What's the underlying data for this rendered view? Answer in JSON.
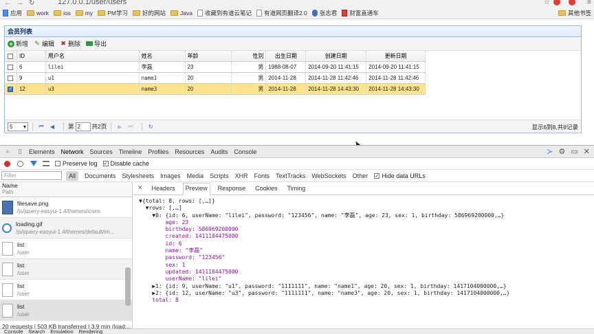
{
  "browser": {
    "url": "127.0.0.1/user/users",
    "bookmarks": [
      "应用",
      "work",
      "ios",
      "my",
      "PM学习",
      "好的网站",
      "Java",
      "收藏到有道云笔记",
      "有道网页翻译2.0",
      "张志君",
      "财富直通车"
    ],
    "other_bookmarks": "其他书签"
  },
  "panel": {
    "title": "会员列表",
    "toolbar": {
      "add": "新增",
      "edit": "编辑",
      "delete": "删除",
      "export": "导出"
    },
    "columns": [
      "ID",
      "用户名",
      "姓名",
      "年龄",
      "性别",
      "出生日期",
      "创建日期",
      "更新日期"
    ],
    "rows": [
      {
        "id": "6",
        "username": "lilei",
        "name": "李磊",
        "age": "23",
        "sex": "男",
        "birthday": "1988-08-07",
        "created": "2014-09-20 11:41:15",
        "updated": "2014-09-20 11:41:15",
        "checked": false
      },
      {
        "id": "9",
        "username": "u1",
        "name": "name1",
        "age": "20",
        "sex": "男",
        "birthday": "2014-11-28",
        "created": "2014-11-28 11:42:46",
        "updated": "2014-11-28 11:42:46",
        "checked": false
      },
      {
        "id": "12",
        "username": "u3",
        "name": "name3",
        "age": "20",
        "sex": "男",
        "birthday": "2014-11-28",
        "created": "2014-11-28 14:43:30",
        "updated": "2014-11-28 14:43:30",
        "checked": true
      }
    ],
    "pager": {
      "page_size": "5",
      "page_prefix": "第",
      "page": "2",
      "page_suffix": "共2页",
      "info": "显示6到8,共8记录"
    }
  },
  "devtools": {
    "tabs": [
      "Elements",
      "Network",
      "Sources",
      "Timeline",
      "Profiles",
      "Resources",
      "Audits",
      "Console"
    ],
    "active_tab": "Network",
    "preserve_log": "Preserve log",
    "disable_cache": "Disable cache",
    "filter_placeholder": "Filter",
    "filter_types": [
      "All",
      "Documents",
      "Stylesheets",
      "Images",
      "Media",
      "Scripts",
      "XHR",
      "Fonts",
      "TextTracks",
      "WebSockets",
      "Other"
    ],
    "hide_data_urls": "Hide data URLs",
    "list_header": {
      "name": "Name",
      "path": "Path"
    },
    "requests": [
      {
        "name": "filesave.png",
        "path": "/js/jquery-easyui-1.4/themes/icons",
        "icon": "floppy"
      },
      {
        "name": "loading.gif",
        "path": "/js/jquery-easyui-1.4/themes/default/im...",
        "icon": "spinner"
      },
      {
        "name": "list",
        "path": "/user",
        "icon": "doc"
      },
      {
        "name": "list",
        "path": "/user",
        "icon": "doc"
      },
      {
        "name": "list",
        "path": "/user",
        "icon": "doc"
      },
      {
        "name": "list",
        "path": "/user",
        "icon": "doc"
      }
    ],
    "summary": "20 requests | 503 KB transferred | 3.9 min (load:...",
    "detail_tabs": [
      "Headers",
      "Preview",
      "Response",
      "Cookies",
      "Timing"
    ],
    "active_detail_tab": "Preview",
    "preview_lines": [
      "▼{total: 8, rows: [,…]}",
      "  ▼rows: [,…]",
      "    ▼0: {id: 6, userName: \"lilei\", password: \"123456\", name: \"李磊\", age: 23, sex: 1, birthday: 586969200000,…}",
      "        age: 23",
      "        birthday: 586969200000",
      "        created: 1411184475000",
      "        id: 6",
      "        name: \"李磊\"",
      "        password: \"123456\"",
      "        sex: 1",
      "        updated: 1411184475000",
      "        userName: \"lilei\"",
      "    ▶1: {id: 9, userName: \"u1\", password: \"1111111\", name: \"name1\", age: 20, sex: 1, birthday: 1417104000000,…}",
      "    ▶2: {id: 12, userName: \"u3\", password: \"1111111\", name: \"name3\", age: 20, sex: 1, birthday: 1417104000000,…}",
      "    total: 8"
    ],
    "drawer_tabs": [
      "Console",
      "Search",
      "Emulation",
      "Rendering"
    ]
  }
}
